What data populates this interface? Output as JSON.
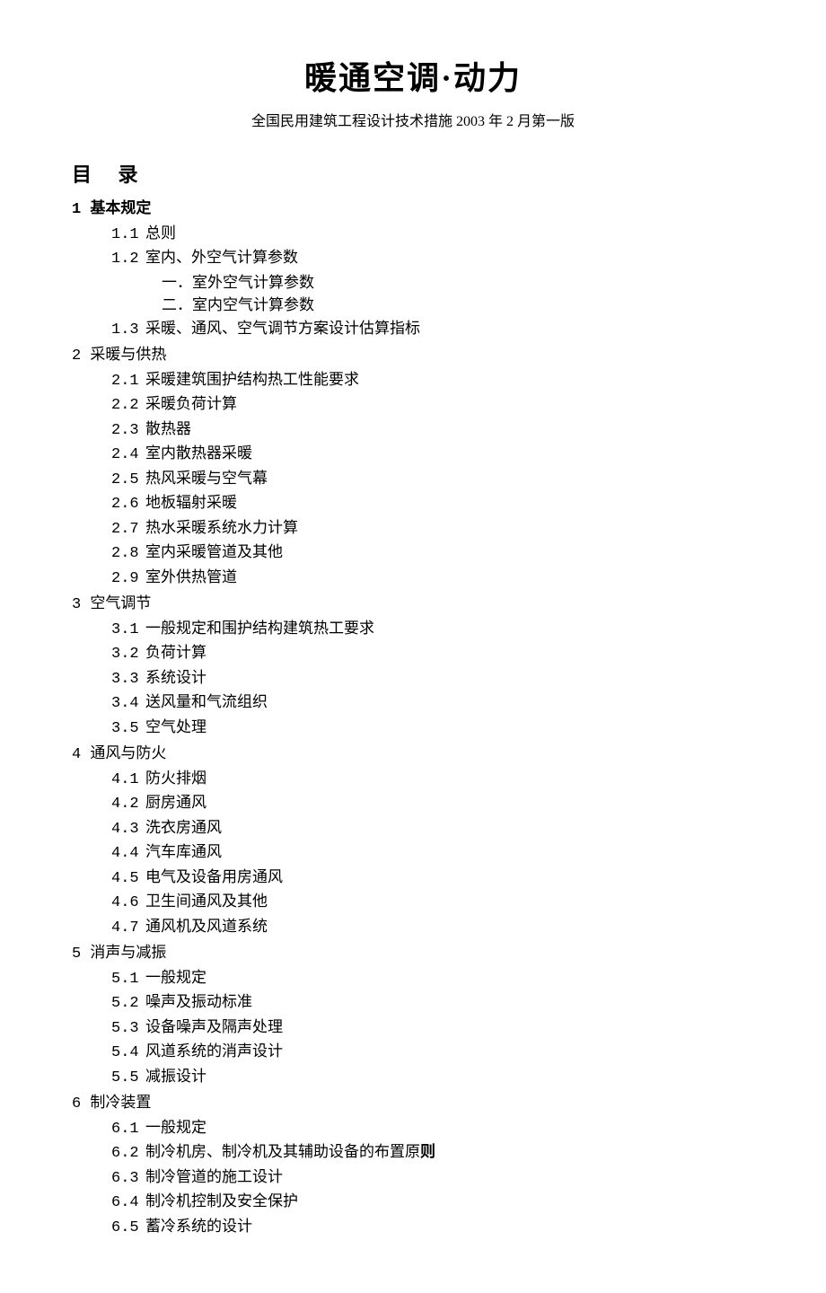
{
  "title": "暖通空调·动力",
  "subtitle": "全国民用建筑工程设计技术措施 2003 年 2 月第一版",
  "toc_label": "目 录",
  "chapters": [
    {
      "num": "1",
      "title": "基本规定",
      "bold": true,
      "sections": [
        {
          "num": "1.1",
          "title": "总则"
        },
        {
          "num": "1.2",
          "title": "室内、外空气计算参数",
          "subs": [
            {
              "num": "一．",
              "title": "室外空气计算参数"
            },
            {
              "num": "二．",
              "title": "室内空气计算参数"
            }
          ]
        },
        {
          "num": "1.3",
          "title": "采暖、通风、空气调节方案设计估算指标"
        }
      ]
    },
    {
      "num": "2",
      "title": "采暖与供热",
      "sections": [
        {
          "num": "2.1",
          "title": "采暖建筑围护结构热工性能要求"
        },
        {
          "num": "2.2",
          "title": "采暖负荷计算"
        },
        {
          "num": "2.3",
          "title": "散热器"
        },
        {
          "num": "2.4",
          "title": "室内散热器采暖"
        },
        {
          "num": "2.5",
          "title": "热风采暖与空气幕"
        },
        {
          "num": "2.6",
          "title": "地板辐射采暖"
        },
        {
          "num": "2.7",
          "title": "热水采暖系统水力计算"
        },
        {
          "num": "2.8",
          "title": "室内采暖管道及其他"
        },
        {
          "num": "2.9",
          "title": "室外供热管道"
        }
      ]
    },
    {
      "num": "3",
      "title": "空气调节",
      "sections": [
        {
          "num": "3.1",
          "title": "一般规定和围护结构建筑热工要求"
        },
        {
          "num": "3.2",
          "title": "负荷计算"
        },
        {
          "num": "3.3",
          "title": "系统设计"
        },
        {
          "num": "3.4",
          "title": "送风量和气流组织"
        },
        {
          "num": "3.5",
          "title": "空气处理"
        }
      ]
    },
    {
      "num": "4",
      "title": "通风与防火",
      "sections": [
        {
          "num": "4.1",
          "title": "防火排烟"
        },
        {
          "num": "4.2",
          "title": "厨房通风"
        },
        {
          "num": "4.3",
          "title": "洗衣房通风"
        },
        {
          "num": "4.4",
          "title": "汽车库通风"
        },
        {
          "num": "4.5",
          "title": "电气及设备用房通风"
        },
        {
          "num": "4.6",
          "title": "卫生间通风及其他"
        },
        {
          "num": "4.7",
          "title": "通风机及风道系统"
        }
      ]
    },
    {
      "num": "5",
      "title": "消声与减振",
      "sections": [
        {
          "num": "5.1",
          "title": "一般规定"
        },
        {
          "num": "5.2",
          "title": "噪声及振动标准"
        },
        {
          "num": "5.3",
          "title": "设备噪声及隔声处理"
        },
        {
          "num": "5.4",
          "title": "风道系统的消声设计"
        },
        {
          "num": "5.5",
          "title": "减振设计"
        }
      ]
    },
    {
      "num": "6",
      "title": "制冷装置",
      "sections": [
        {
          "num": "6.1",
          "title": "一般规定"
        },
        {
          "num": "6.2",
          "title_prefix": "制冷机房、制冷机及其辅助设备的布置原",
          "title_bold_suffix": "则"
        },
        {
          "num": "6.3",
          "title": "制冷管道的施工设计"
        },
        {
          "num": "6.4",
          "title": "制冷机控制及安全保护"
        },
        {
          "num": "6.5",
          "title": "蓄冷系统的设计"
        }
      ]
    }
  ]
}
